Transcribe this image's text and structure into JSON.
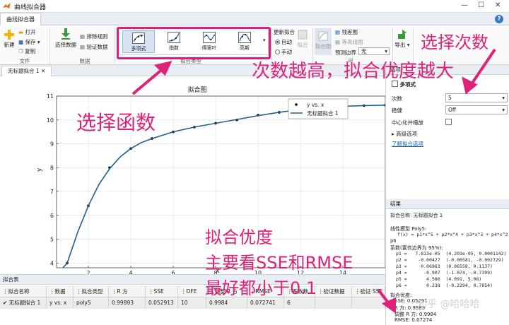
{
  "window": {
    "title": "曲线拟合器"
  },
  "ribbon": {
    "tab": "曲线拟合器",
    "file": {
      "new": "新建",
      "open": "打开",
      "save": "保存",
      "copy": "复制",
      "section": "文件"
    },
    "data": {
      "select": "选择数据",
      "exclude": "排除规则",
      "validate": "验证数据",
      "section": "数据"
    },
    "fit_type": {
      "items": [
        "多项式",
        "指数",
        "傅里叶",
        "高斯"
      ],
      "section": "拟合类型"
    },
    "fit": {
      "update": "更新拟合",
      "auto": "自动",
      "manual": "手动",
      "fit_btn": "拟合"
    },
    "visual": {
      "fit_plot": "拟合图",
      "residuals": "残差图",
      "contour": "等高线图",
      "bounds_label": "预测边界",
      "bounds_value": "无",
      "section": "可"
    },
    "export": {
      "label": "导出"
    }
  },
  "doc_tab": "无标题拟合 1",
  "plot": {
    "title": "拟合图",
    "legend": [
      "y vs. x",
      "无标题拟合 1"
    ],
    "xlabel": "x",
    "ylabel": "y"
  },
  "chart_data": {
    "type": "line",
    "title": "拟合图",
    "xlabel": "x",
    "ylabel": "y",
    "xlim": [
      0.5,
      16
    ],
    "ylim": [
      3.8,
      11
    ],
    "xticks": [
      2,
      4,
      6,
      8,
      10,
      12,
      14
    ],
    "yticks": [
      4,
      5,
      6,
      7,
      8,
      9,
      10,
      11
    ],
    "grid": true,
    "legend_position": "top-right",
    "series": [
      {
        "name": "y vs. x",
        "kind": "points",
        "x": [
          1,
          2,
          3,
          4,
          5,
          6,
          7,
          8,
          9,
          10,
          11,
          12,
          13,
          14,
          15,
          16
        ],
        "y": [
          4.0,
          6.4,
          8.0,
          8.8,
          9.22,
          9.5,
          9.7,
          9.86,
          10.0,
          10.2,
          10.32,
          10.42,
          10.5,
          10.58,
          10.6,
          10.62
        ]
      },
      {
        "name": "无标题拟合 1",
        "kind": "line",
        "x": [
          0.8,
          1.0,
          1.5,
          2.0,
          2.5,
          3.0,
          3.5,
          4.0,
          4.5,
          5.0,
          6.0,
          7.0,
          8.0,
          9.0,
          10.0,
          11.0,
          12.0,
          13.0,
          14.0,
          15.0,
          16.0
        ],
        "y": [
          3.5,
          4.0,
          5.3,
          6.4,
          7.3,
          7.95,
          8.45,
          8.8,
          9.05,
          9.22,
          9.5,
          9.7,
          9.86,
          10.02,
          10.18,
          10.32,
          10.44,
          10.52,
          10.57,
          10.6,
          10.62
        ]
      }
    ]
  },
  "options": {
    "header": "选项",
    "model": "多项式",
    "degree_label": "次数",
    "degree_value": "5",
    "robust_label": "稳健",
    "robust_value": "Off",
    "center_label": "中心化并缩放",
    "advanced": "高级选项",
    "learn_more": "了解拟合选项"
  },
  "results": {
    "header": "结果",
    "fit_name": "拟合名称: 无标题拟合 1",
    "linear_model": "线性模型 Poly5:",
    "formula": "f(x) = p1*x^5 + p2*x^4 + p3*x^3 + p4*x^2 + p5*x +",
    "formula2": "p6",
    "coef_title": "系数(置信边界为 95%):",
    "coefs": [
      "p1 =   7.813e-05  (4.203e-05, 0.0001142)",
      "p2 =    -0.00427  (-0.00581, -0.002729)",
      "p3 =     0.06963  (0.06558, 0.1137)",
      "p4 =      -0.907  (-1.074, -0.7399)",
      "p5 =       4.586  (4.091, 5.08)",
      "p6 =       0.238  (-0.2294, 0.7054)"
    ],
    "gof_title": "拟合优度:",
    "gof": [
      "SSE: 0.05291",
      "R 方: 0.9989",
      "调整 R 方: 0.9984",
      "RMSE: 0.07274"
    ]
  },
  "fit_table": {
    "header": "拟合表",
    "columns": [
      "拟合名称",
      "数据",
      "拟合类型",
      "R 方",
      "SSE",
      "DFE",
      "调整 R 方",
      "RMSE",
      "系数数",
      "验证数据",
      "验证 SSE"
    ],
    "row": [
      "无标题拟合 1",
      "y vs. x",
      "poly5",
      "0.99893",
      "0.052913",
      "10",
      "0.9984",
      "0.072741",
      "6",
      "",
      ""
    ]
  },
  "annotations": {
    "select_function": "选择函数",
    "select_degree": "选择次数",
    "higher_degree": "次数越高，拟合优度越大",
    "gof_line1": "拟合优度",
    "gof_line2": "主要看SSE和RMSE",
    "gof_line3": "最好都小于0.1",
    "watermark": "知乎 @哈哈哈"
  },
  "colors": {
    "annotation": "#e0217a",
    "fit_line": "#1f5f8b",
    "accent": "#225ea8"
  }
}
